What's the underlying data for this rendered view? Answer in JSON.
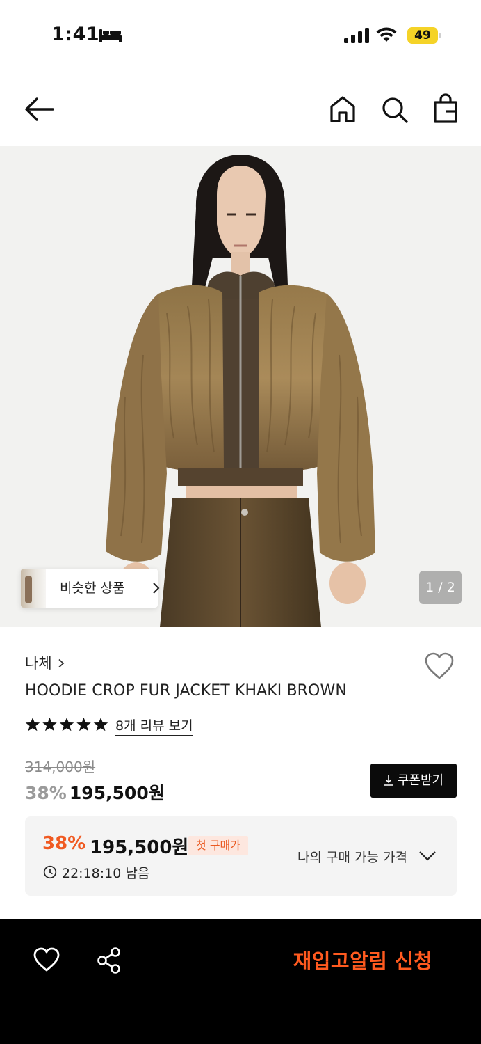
{
  "status_bar": {
    "time": "1:41",
    "battery": "49",
    "icons": [
      "bed-icon",
      "signal-icon",
      "wifi-icon",
      "battery-icon"
    ]
  },
  "nav": {
    "icons": [
      "back-arrow-icon",
      "home-icon",
      "search-icon",
      "shopping-bag-icon"
    ]
  },
  "gallery": {
    "similar_label": "비슷한 상품",
    "pager": "1 / 2"
  },
  "product": {
    "brand": "나체",
    "name": "HOODIE CROP FUR JACKET KHAKI BROWN",
    "rating_stars": 5,
    "review_link": "8개 리뷰 보기",
    "original_price": "314,000원",
    "discount": "38%",
    "sale_price": "195,500원",
    "coupon_label": "쿠폰받기"
  },
  "offer": {
    "discount": "38%",
    "price": "195,500원",
    "badge": "첫 구매가",
    "timer": "22:18:10 남음",
    "my_price_label": "나의 구매 가능 가격"
  },
  "bottom_bar": {
    "restock_label": "재입고알림 신청"
  },
  "colors": {
    "accent": "#f05a22",
    "bottom_bar": "#000000",
    "battery": "#f5d327"
  }
}
